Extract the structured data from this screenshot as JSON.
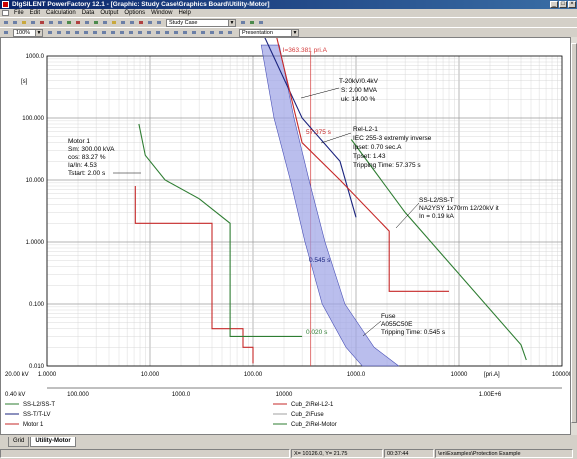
{
  "window": {
    "title": "DIgSILENT PowerFactory 12.1 - [Graphic: Study Case\\Graphics Board\\Utility-Motor]",
    "controls": [
      "minimize-icon",
      "maximize-icon",
      "close-icon"
    ]
  },
  "menu": [
    "File",
    "Edit",
    "Calculation",
    "Data",
    "Output",
    "Options",
    "Window",
    "Help"
  ],
  "toolbar": {
    "study_case": "Study Case",
    "zoom": "100%",
    "layer_mode": "Presentation"
  },
  "chart_data": {
    "type": "line",
    "title": "",
    "current_readout": "I=363.381 pri.A",
    "xlim": [
      1,
      100000
    ],
    "ylim": [
      0.01,
      1000
    ],
    "x_scale": "log",
    "y_scale": "log",
    "grid": true,
    "legend_position": "bottom",
    "ylabel": "[s]",
    "xlabel": "[pri.A]",
    "y_ticks": [
      "1000.0",
      "100.000",
      "10.000",
      "1.0000",
      "0.100",
      "0.010"
    ],
    "x_axes": [
      {
        "voltage": "20.00 kV",
        "ticks": [
          "1.0000",
          "10.000",
          "100.00",
          "1000.0",
          "10000",
          "100000"
        ]
      },
      {
        "voltage": "0.40 kV",
        "ticks": [
          "100.000",
          "1000.0",
          "10000",
          "1.00E+6"
        ]
      }
    ],
    "annotations": {
      "transformer": [
        "T-20kV/0.4kV",
        "S: 2.00 MVA",
        "uk: 14.00 %"
      ],
      "relay": [
        "Rel-L2-1",
        "IEC 255-3 extremly inverse",
        "Ipset: 0.70 sec.A",
        "Tpset: 1.43",
        "Tripping Time: 57.375 s"
      ],
      "motor": [
        "Motor 1",
        "Sm: 300.00 kVA",
        "cos: 83.27 %",
        "Ia/In: 4.53",
        "Tstart: 2.00 s"
      ],
      "cable": [
        "SS-L2/SS-T",
        "NA2YSY 1x70rm 12/20kV it",
        "In = 0.19 kA"
      ],
      "fuse": [
        "Fuse",
        "A055C50E",
        "Tripping Time: 0.545 s"
      ],
      "relay_time": "57.375 s",
      "fuse_time": "0.545 s",
      "motor_time": "0.020 s"
    },
    "series": [
      {
        "name": "SS-L2/SS-T",
        "color": "#2e7d32",
        "x": [
          900,
          3000,
          40000,
          45000
        ],
        "y": [
          45,
          3,
          0.022,
          0.0125
        ]
      },
      {
        "name": "SS-T/T-LV",
        "color": "#1a237e",
        "x": [
          130,
          300,
          700,
          1000
        ],
        "y": [
          2000,
          100,
          20,
          2.5
        ]
      },
      {
        "name": "Motor 1",
        "color": "#c62828",
        "x": [
          7.2,
          7.2,
          40,
          40,
          80,
          80,
          100,
          100
        ],
        "y": [
          8,
          2,
          2,
          0.04,
          0.04,
          0.02,
          0.02,
          0.011
        ]
      },
      {
        "name": "Cub_2\\Rel-L2-1",
        "color": "#c62828",
        "x": [
          170,
          300,
          700,
          2100,
          2100,
          8000
        ],
        "y": [
          2000,
          40,
          10,
          1.5,
          0.16,
          0.16
        ]
      },
      {
        "name": "Cub_2\\Fuse",
        "color": "#a0a0a0",
        "x": [],
        "y": []
      },
      {
        "name": "Cub_2\\Rel-Motor",
        "color": "#2e7d32",
        "x": [
          7.8,
          9,
          14,
          30,
          60,
          60,
          300
        ],
        "y": [
          80,
          25,
          10,
          5,
          2,
          0.03,
          0.03
        ]
      }
    ],
    "fuse_band": {
      "name": "Fuse",
      "color": "#8a8fd8"
    }
  },
  "legend": [
    {
      "label": "SS-L2/SS-T",
      "color": "#2e7d32"
    },
    {
      "label": "Cub_2\\Rel-L2-1",
      "color": "#c62828"
    },
    {
      "label": "SS-T/T-LV",
      "color": "#1a237e"
    },
    {
      "label": "Cub_2\\Fuse",
      "color": "#a0a0a0"
    },
    {
      "label": "Motor 1",
      "color": "#c62828"
    },
    {
      "label": "Cub_2\\Rel-Motor",
      "color": "#2e7d32"
    }
  ],
  "tabs": [
    "Grid",
    "Utility-Motor"
  ],
  "status": {
    "coords": "X= 10126.0, Y= 21.75",
    "extra": "00:37:44",
    "path": "\\en\\Examples\\Protection Example"
  }
}
